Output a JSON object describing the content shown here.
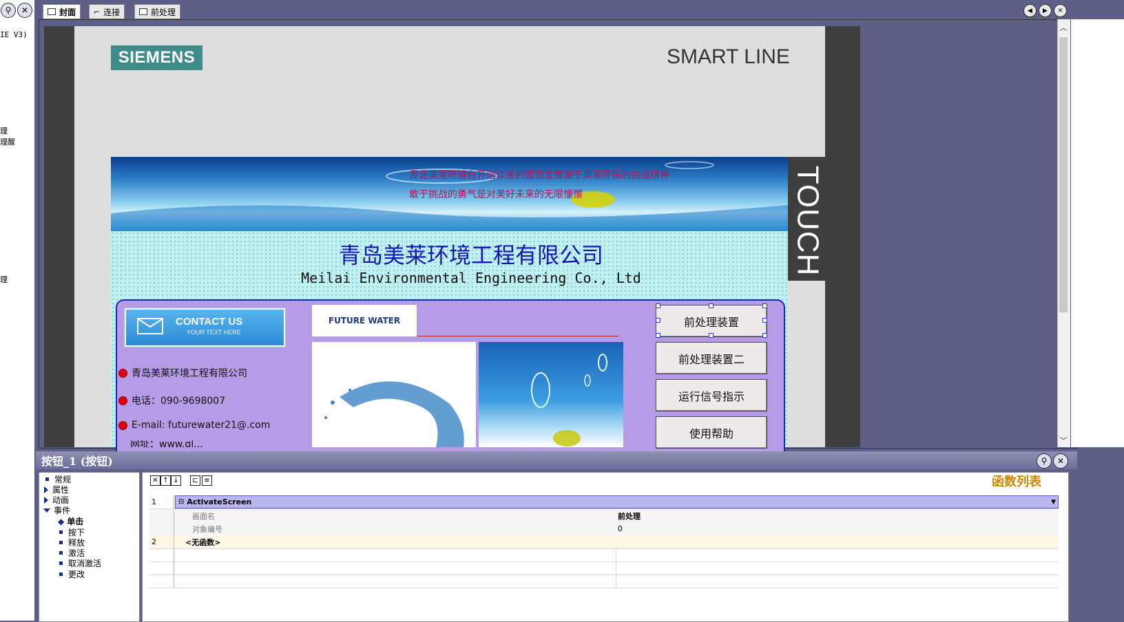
{
  "left_tree": {
    "items": [
      "IE V3)",
      "理",
      "理醒",
      "理"
    ]
  },
  "tabs": [
    {
      "label": "封面",
      "active": true
    },
    {
      "label": "连接",
      "active": false
    },
    {
      "label": "前处理",
      "active": false
    }
  ],
  "hmi": {
    "brand": "SIEMENS",
    "product_line": "SMART LINE",
    "touch_label": "TOUCH",
    "banner_text_1": "青岛美莱环境自开创以来的蓬勃发展源于美莱环保的挑战精神",
    "banner_text_2": "敢于挑战的勇气是对美好未来的无限憧憬",
    "company_cn": "青岛美莱环境工程有限公司",
    "company_en": "Meilai Environmental Engineering Co., Ltd",
    "contact_title": "CONTACT US",
    "contact_sub": "YOUR TEXT HERE",
    "logo_text": "FUTURE WATER",
    "info": [
      "青岛美莱环境工程有限公司",
      "电话：090-9698007",
      "E-mail: futurewater21@.com",
      "网址：www.ql..."
    ],
    "buttons": [
      "前处理装置",
      "前处理装置二",
      "运行信号指示",
      "使用帮助"
    ]
  },
  "properties": {
    "title": "按钮_1 (按钮)",
    "function_list_title": "函数列表",
    "tree": [
      {
        "label": "常规",
        "kind": "leaf"
      },
      {
        "label": "属性",
        "kind": "collapsed"
      },
      {
        "label": "动画",
        "kind": "collapsed"
      },
      {
        "label": "事件",
        "kind": "expanded"
      },
      {
        "label": "单击",
        "kind": "selected"
      },
      {
        "label": "按下",
        "kind": "child"
      },
      {
        "label": "释放",
        "kind": "child"
      },
      {
        "label": "激活",
        "kind": "child"
      },
      {
        "label": "取消激活",
        "kind": "child"
      },
      {
        "label": "更改",
        "kind": "child"
      }
    ],
    "functions": {
      "row1_num": "1",
      "row1_name": "ActivateScreen",
      "param1_name": "画面名",
      "param1_value": "前处理",
      "param2_name": "对象编号",
      "param2_value": "0",
      "row2_num": "2",
      "row2_name": "<无函数>"
    }
  },
  "colors": {
    "workspace": "#5e5f86",
    "panel": "#b69be6",
    "company_title": "#1515b0",
    "function_list_title": "#cc8800"
  }
}
